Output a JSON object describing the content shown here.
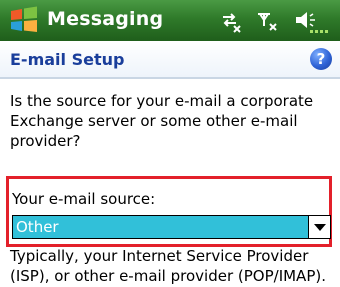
{
  "titlebar": {
    "app_title": "Messaging",
    "start_icon": "windows-flag-icon",
    "status_icons": [
      "sync-icon",
      "no-signal-icon",
      "speaker-icon"
    ]
  },
  "header": {
    "title": "E-mail Setup",
    "help_icon": "help-icon",
    "help_glyph": "?"
  },
  "content": {
    "question": "Is the source for your e-mail a corporate Exchange server or some other e-mail provider?",
    "source_label": "Your e-mail source:",
    "source_selected": "Other",
    "helper_text": "Typically, your Internet Service Provider (ISP), or other e-mail provider (POP/IMAP)."
  },
  "colors": {
    "titlebar": "#2f7a2a",
    "header_text": "#1a3e9b",
    "highlight_border": "#e3202a",
    "select_bg": "#31c0d9"
  }
}
